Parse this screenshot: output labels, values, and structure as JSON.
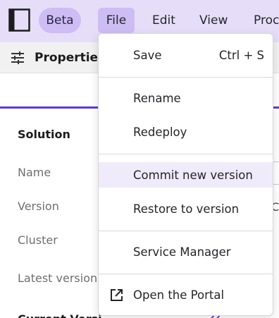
{
  "topbar": {
    "badge": "Beta",
    "menus": [
      {
        "label": "File"
      },
      {
        "label": "Edit"
      },
      {
        "label": "View"
      },
      {
        "label": "Proc"
      }
    ]
  },
  "properties": {
    "title": "Properties",
    "section_heading": "Solution",
    "fields": [
      {
        "label": "Name"
      },
      {
        "label": "Version"
      },
      {
        "label": "Cluster"
      },
      {
        "label": "Latest version"
      }
    ],
    "cut_text": "Current Versi",
    "partial_value": "C"
  },
  "file_menu": {
    "save": {
      "label": "Save",
      "shortcut": "Ctrl + S"
    },
    "rename": "Rename",
    "redeploy": "Redeploy",
    "commit": "Commit new version",
    "restore": "Restore to version",
    "service_manager": "Service Manager",
    "open_portal": "Open the Portal"
  },
  "icons": {
    "logo": "app-logo-icon",
    "properties": "sliders-icon",
    "portal": "external-link-icon"
  },
  "colors": {
    "topbar_bg": "#e6def9",
    "badge_bg": "#cdbdf4",
    "accent": "#5b3fc9",
    "highlight": "#efebfb"
  }
}
